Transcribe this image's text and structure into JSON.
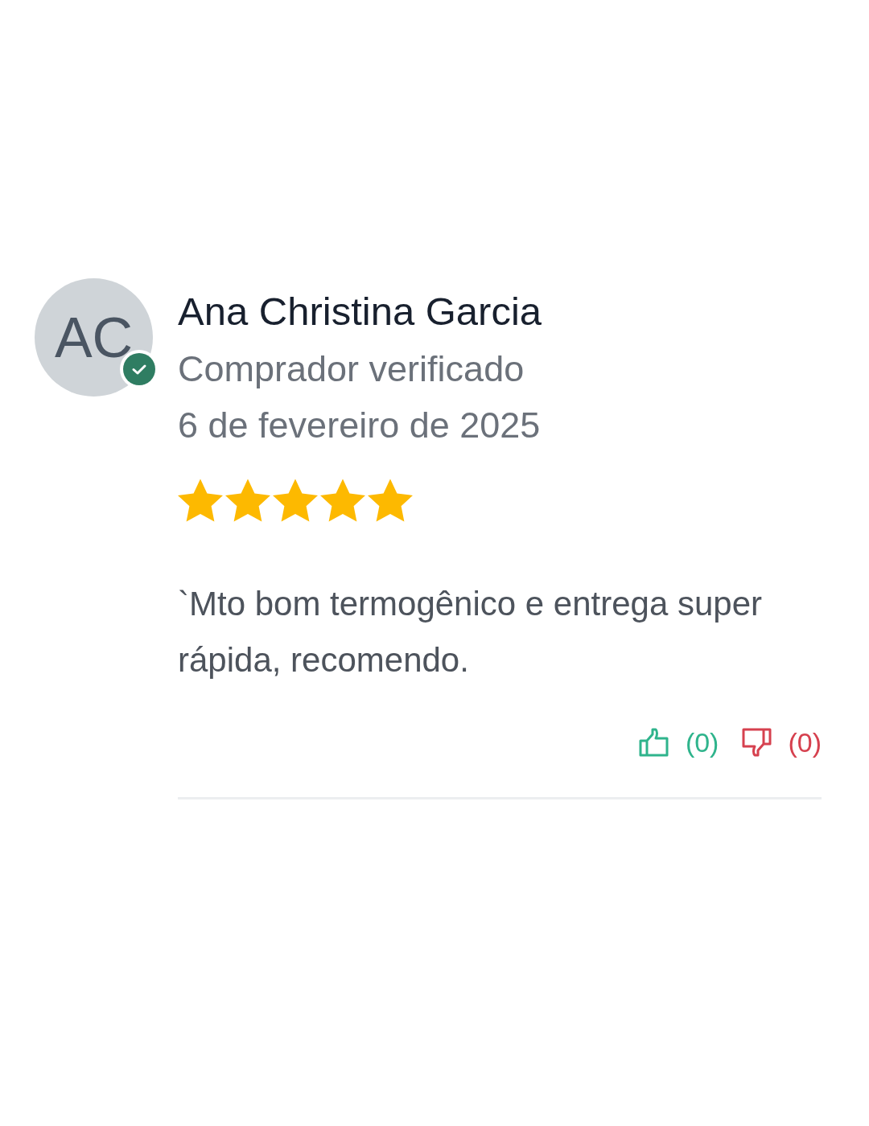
{
  "review": {
    "avatar": {
      "initials": "AC",
      "verified": true
    },
    "author": "Ana Christina Garcia",
    "badge": "Comprador verificado",
    "date": "6 de fevereiro de 2025",
    "stars": 5,
    "text": "`Mto bom termogênico e entrega super rápida, recomendo.",
    "votes": [
      {
        "kind": "up",
        "count": "(0)"
      },
      {
        "kind": "down",
        "count": "(0)"
      }
    ]
  }
}
